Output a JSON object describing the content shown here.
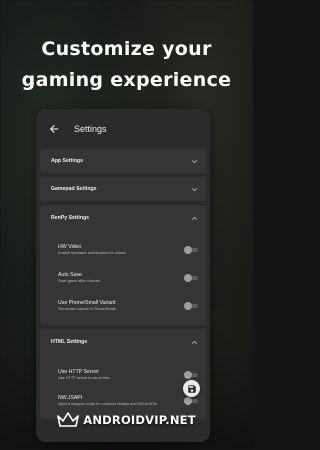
{
  "headline": {
    "line1": "Customize your",
    "line2": "gaming experience"
  },
  "appbar": {
    "title": "Settings",
    "back_icon": "arrow-back-icon"
  },
  "sections": {
    "app": {
      "title": "App Settings",
      "state": "collapsed"
    },
    "gamepad": {
      "title": "Gamepad Settings",
      "state": "collapsed"
    },
    "renpy": {
      "title": "RenPy Settings",
      "state": "expanded",
      "items": [
        {
          "title": "HW Video",
          "subtitle": "Enable hardware acceleration for videos.",
          "on": false
        },
        {
          "title": "Auto Save",
          "subtitle": "Save game after choices.",
          "on": false
        },
        {
          "title": "Use Phone/Small Variant",
          "subtitle": "Set screen variant to Phone/Small.",
          "on": false
        }
      ]
    },
    "html": {
      "title": "HTML Settings",
      "state": "expanded",
      "items": [
        {
          "title": "Use HTTP Server",
          "subtitle": "Use HTTP server to serve files.",
          "on": false
        },
        {
          "title": "NW.JSAPI",
          "subtitle": "Inject a wrapper script for common Nodejs and NWJs APIs",
          "on": false
        }
      ]
    }
  },
  "fab_icon": "save-icon",
  "watermark": "ANDROIDVIP.NET",
  "colors": {
    "panel": "#2b2b2b",
    "section": "#353535",
    "toggle_track": "#5a5a5a",
    "toggle_knob": "#9e9e9e"
  }
}
